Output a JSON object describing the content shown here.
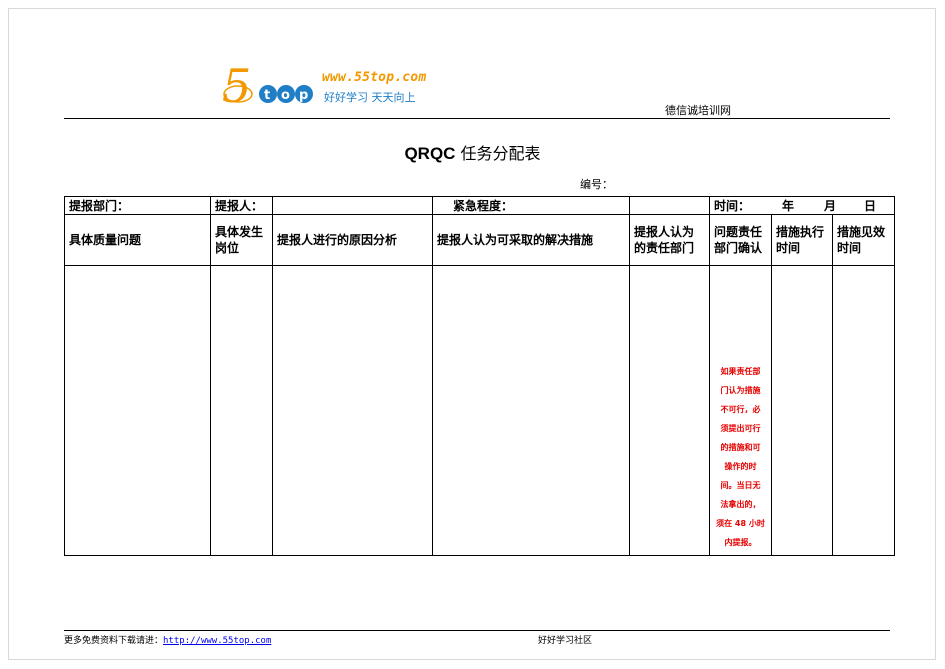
{
  "header": {
    "logo_url": "www.55top.com",
    "logo_slogan": "好好学习  天天向上",
    "logo_mark_text": "5top",
    "site_name": "德信诚培训网"
  },
  "title": {
    "bold": "QRQC",
    "rest": "任务分配表"
  },
  "serial_label": "编号：",
  "form": {
    "row1": {
      "dept_label": "提报部门：",
      "reporter_label": "提报人：",
      "urgency_label": "紧急程度：",
      "time_label": "时间：",
      "year": "年",
      "month": "月",
      "day": "日"
    },
    "columns": [
      "具体质量问题",
      "具体发生岗位",
      "提报人进行的原因分析",
      "提报人认为可采取的解决措施",
      "提报人认为的责任部门",
      "问题责任部门确认",
      "措施执行时间",
      "措施见效时间"
    ],
    "note_lines": [
      "如果责任部",
      "门认为措施",
      "不可行，必",
      "须提出可行",
      "的措施和可",
      "操作的时",
      "间。当日无",
      "法拿出的，",
      "须在 48 小时",
      "内提报。"
    ]
  },
  "footer": {
    "left_text": "更多免费资料下载请进：",
    "left_link": "http://www.55top.com",
    "center_text": "好好学习社区"
  },
  "colors": {
    "note": "#e60000",
    "logo_orange": "#f39800",
    "logo_blue": "#1f7ec6",
    "link": "#0000ee"
  }
}
